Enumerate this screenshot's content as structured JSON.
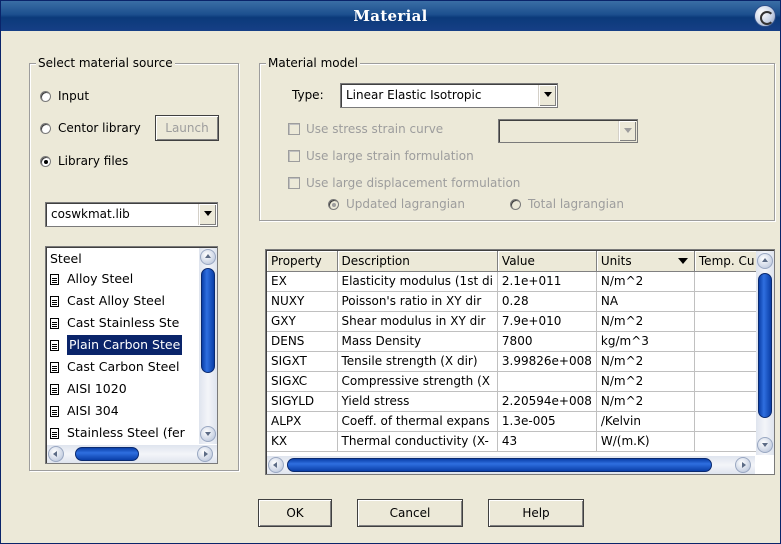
{
  "window": {
    "title": "Material"
  },
  "source": {
    "legend": "Select material source",
    "options": [
      "Input",
      "Centor library",
      "Library files"
    ],
    "selected": "Library files",
    "launch_label": "Launch",
    "library_file": "coswkmat.lib",
    "tree": {
      "root": "Steel",
      "items": [
        "Alloy Steel",
        "Cast Alloy Steel",
        "Cast Stainless Ste",
        "Plain Carbon Stee",
        "Cast Carbon Steel",
        "AISI 1020",
        "AISI 304",
        "Stainless Steel (fer"
      ],
      "selected": "Plain Carbon Stee"
    }
  },
  "model": {
    "legend": "Material model",
    "type_label": "Type:",
    "type_value": "Linear Elastic Isotropic",
    "checkboxes": [
      "Use stress strain curve",
      "Use large strain formulation",
      "Use large displacement formulation"
    ],
    "radios": [
      "Updated lagrangian",
      "Total lagrangian"
    ],
    "radio_selected": "Updated lagrangian"
  },
  "table": {
    "headers": [
      "Property",
      "Description",
      "Value",
      "Units",
      "Temp. Cu"
    ],
    "rows": [
      [
        "EX",
        "Elasticity modulus (1st di",
        "2.1e+011",
        "N/m^2",
        ""
      ],
      [
        "NUXY",
        "Poisson's ratio in XY dir",
        "0.28",
        "NA",
        ""
      ],
      [
        "GXY",
        "Shear modulus in XY dir",
        "7.9e+010",
        "N/m^2",
        ""
      ],
      [
        "DENS",
        "Mass Density",
        "7800",
        "kg/m^3",
        ""
      ],
      [
        "SIGXT",
        "Tensile strength  (X dir)",
        "3.99826e+008",
        "N/m^2",
        ""
      ],
      [
        "SIGXC",
        "Compressive strength (X",
        "",
        "N/m^2",
        ""
      ],
      [
        "SIGYLD",
        "Yield stress",
        "2.20594e+008",
        "N/m^2",
        ""
      ],
      [
        "ALPX",
        "Coeff. of thermal expans",
        "1.3e-005",
        "/Kelvin",
        ""
      ],
      [
        "KX",
        "Thermal conductivity (X-",
        "43",
        "W/(m.K)",
        ""
      ]
    ]
  },
  "buttons": {
    "ok": "OK",
    "cancel": "Cancel",
    "help": "Help"
  }
}
